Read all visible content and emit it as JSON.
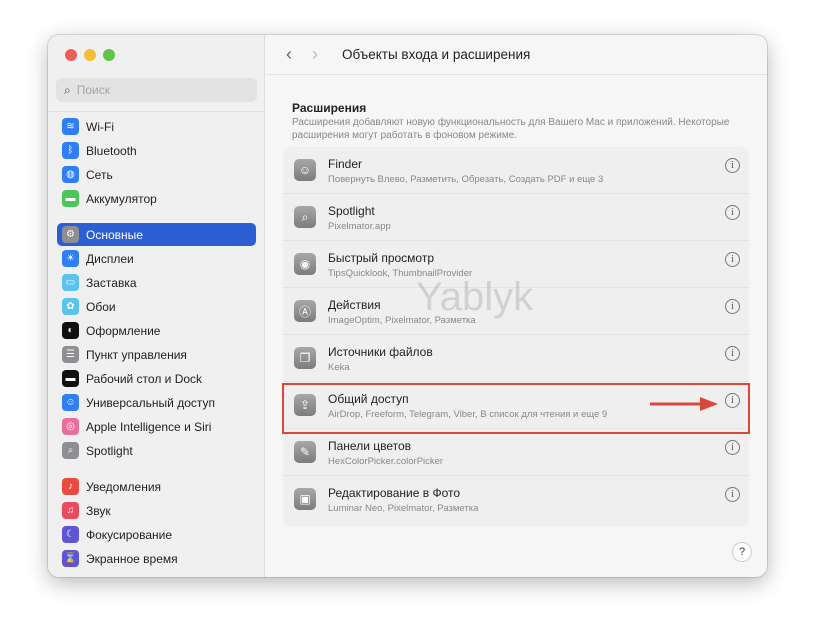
{
  "window": {
    "title": "Объекты входа и расширения",
    "traffic_colors": [
      "#ee5e56",
      "#f4bd3b",
      "#5fc548"
    ]
  },
  "search": {
    "placeholder": "Поиск"
  },
  "sidebar": {
    "items": [
      {
        "label": "Wi-Fi",
        "color": "#2f7ef6",
        "icon": "wifi-icon",
        "glyph": "≋"
      },
      {
        "label": "Bluetooth",
        "color": "#2f7ef6",
        "icon": "bluetooth-icon",
        "glyph": "ᛒ"
      },
      {
        "label": "Сеть",
        "color": "#2f7ef6",
        "icon": "globe-icon",
        "glyph": "◍"
      },
      {
        "label": "Аккумулятор",
        "color": "#4cc55a",
        "icon": "battery-icon",
        "glyph": "▬"
      },
      {
        "label": "Основные",
        "color": "#8e8e93",
        "icon": "gear-icon",
        "glyph": "⚙",
        "selected": true
      },
      {
        "label": "Дисплеи",
        "color": "#2f7ef6",
        "icon": "sun-icon",
        "glyph": "☀"
      },
      {
        "label": "Заставка",
        "color": "#5ac3f0",
        "icon": "screensaver-icon",
        "glyph": "▭"
      },
      {
        "label": "Обои",
        "color": "#5ac3f0",
        "icon": "flower-icon",
        "glyph": "✿"
      },
      {
        "label": "Оформление",
        "color": "#111111",
        "icon": "appearance-icon",
        "glyph": "◐"
      },
      {
        "label": "Пункт управления",
        "color": "#8e8e93",
        "icon": "control-center-icon",
        "glyph": "☰"
      },
      {
        "label": "Рабочий стол и Dock",
        "color": "#111111",
        "icon": "dock-icon",
        "glyph": "▬"
      },
      {
        "label": "Универсальный доступ",
        "color": "#2f7ef6",
        "icon": "accessibility-icon",
        "glyph": "☺"
      },
      {
        "label": "Apple Intelligence и Siri",
        "color": "#e7709b",
        "icon": "siri-icon",
        "glyph": "◎"
      },
      {
        "label": "Spotlight",
        "color": "#8e8e93",
        "icon": "search-icon",
        "glyph": "⌕"
      },
      {
        "label": "Уведомления",
        "color": "#ea4a3f",
        "icon": "bell-icon",
        "glyph": "♪"
      },
      {
        "label": "Звук",
        "color": "#ea4a5f",
        "icon": "speaker-icon",
        "glyph": "♫"
      },
      {
        "label": "Фокусирование",
        "color": "#5e55d6",
        "icon": "moon-icon",
        "glyph": "☾"
      },
      {
        "label": "Экранное время",
        "color": "#5e55d6",
        "icon": "hourglass-icon",
        "glyph": "⌛"
      }
    ]
  },
  "main": {
    "section_title": "Расширения",
    "section_desc": "Расширения добавляют новую функциональность для Вашего Mac и приложений. Некоторые расширения могут работать в фоновом режиме.",
    "rows": [
      {
        "name": "Finder",
        "sub": "Повернуть Влево, Разметить, Обрезать, Создать PDF и еще 3",
        "icon": "finder-icon",
        "glyph": "☺"
      },
      {
        "name": "Spotlight",
        "sub": "Pixelmator.app",
        "icon": "search-icon",
        "glyph": "⌕"
      },
      {
        "name": "Быстрый просмотр",
        "sub": "TipsQuicklook, ThumbnailProvider",
        "icon": "eye-icon",
        "glyph": "◉"
      },
      {
        "name": "Действия",
        "sub": "ImageOptim, Pixelmator, Разметка",
        "icon": "actions-icon",
        "glyph": "Ⓐ"
      },
      {
        "name": "Источники файлов",
        "sub": "Keka",
        "icon": "document-icon",
        "glyph": "❐"
      },
      {
        "name": "Общий доступ",
        "sub": "AirDrop, Freeform, Telegram, Viber, В список для чтения и еще 9",
        "icon": "share-icon",
        "glyph": "⇪",
        "highlighted": true
      },
      {
        "name": "Панели цветов",
        "sub": "HexColorPicker.colorPicker",
        "icon": "eyedropper-icon",
        "glyph": "✎"
      },
      {
        "name": "Редактирование в Фото",
        "sub": "Luminar Neo, Pixelmator, Разметка",
        "icon": "photo-icon",
        "glyph": "▣"
      }
    ],
    "info_glyph": "i",
    "help": "?",
    "highlight_color": "#d9483b"
  },
  "watermark": "Yablyk"
}
